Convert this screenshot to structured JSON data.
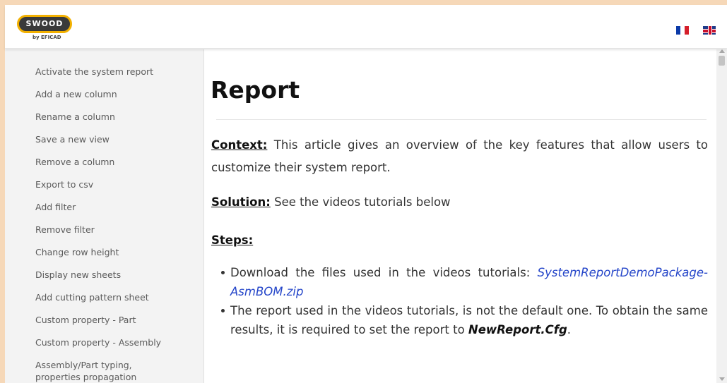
{
  "header": {
    "logo_text": "SWOOD",
    "logo_sub": "by EFICAD",
    "flags": [
      "flag-fr-icon",
      "flag-uk-icon"
    ]
  },
  "sidebar": {
    "items": [
      "Activate the system report",
      "Add a new column",
      "Rename a column",
      "Save a new view",
      "Remove a column",
      "Export to csv",
      "Add filter",
      "Remove filter",
      "Change row height",
      "Display new sheets",
      "Add cutting pattern sheet",
      "Custom property - Part",
      "Custom property - Assembly",
      "Assembly/Part typing,",
      "properties propagation"
    ]
  },
  "main": {
    "title": "Report",
    "context_label": "Context:",
    "context_text": " This article gives an overview of the key features that allow users to customize their system report.",
    "solution_label": "Solution:",
    "solution_text": " See the videos tutorials below",
    "steps_label": "Steps:",
    "steps": [
      {
        "text": "Download the files used in the videos tutorials: ",
        "link": "SystemReportDemoPackage-AsmBOM.zip"
      },
      {
        "text": "The report used in the videos tutorials, is not the default one. To obtain the same results, it is required to set the report to ",
        "strong": "NewReport.Cfg",
        "tail": "."
      }
    ]
  },
  "colors": {
    "frame": "#f6d8b8",
    "sidebar_bg": "#f3f3f3",
    "link": "#2546c9",
    "logo_ring": "#f2b000"
  }
}
